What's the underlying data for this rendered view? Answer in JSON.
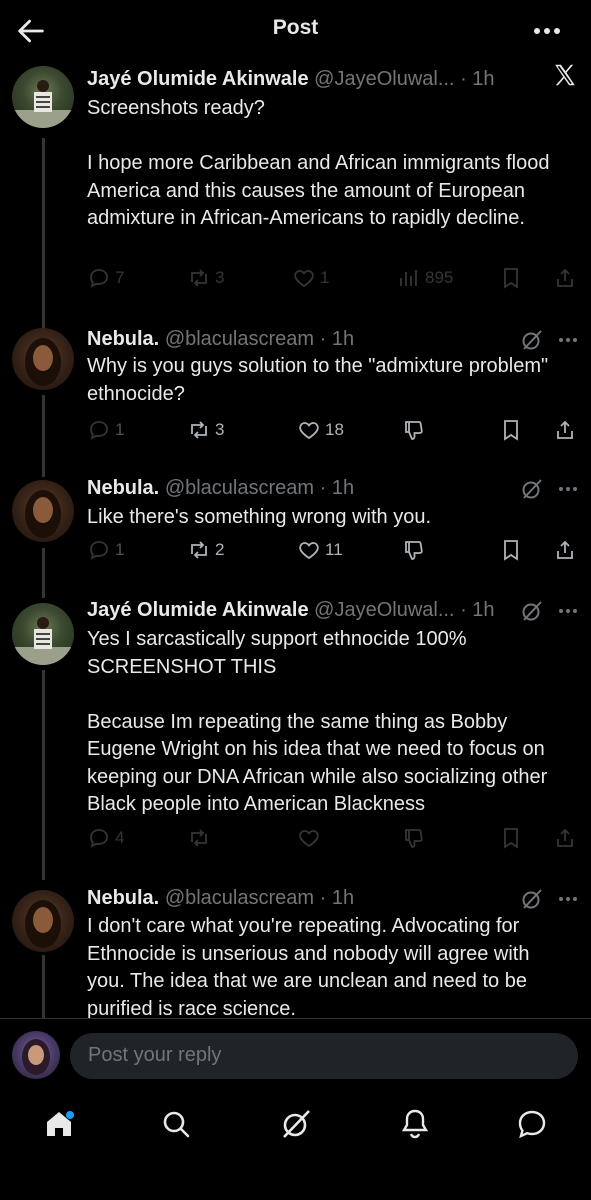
{
  "header": {
    "title": "Post"
  },
  "posts": [
    {
      "name": "Jayé Olumide Akinwale",
      "handle": "@JayeOluwal...",
      "time": "· 1h",
      "text": "Screenshots ready?\n\nI hope more Caribbean and African immigrants flood America and this causes the amount of European admixture in African-Americans to rapidly decline.",
      "replies": "7",
      "reposts": "3",
      "likes": "1",
      "views": "895"
    },
    {
      "name": "Nebula.",
      "handle": "@blaculascream",
      "time": "· 1h",
      "text": "Why is you guys solution to the \"admixture problem\" ethnocide?",
      "replies": "1",
      "reposts": "3",
      "likes": "18"
    },
    {
      "name": "Nebula.",
      "handle": "@blaculascream",
      "time": "· 1h",
      "text": "Like there's something wrong with you.",
      "replies": "1",
      "reposts": "2",
      "likes": "11"
    },
    {
      "name": "Jayé Olumide Akinwale",
      "handle": "@JayeOluwal...",
      "time": "· 1h",
      "text": "Yes I sarcastically support ethnocide 100%\nSCREENSHOT THIS\n\nBecause Im repeating the same thing as Bobby Eugene Wright on his idea that we need to focus on keeping our DNA African while also socializing other Black people into American Blackness",
      "replies": "4"
    },
    {
      "name": "Nebula.",
      "handle": "@blaculascream",
      "time": "· 1h",
      "text": "I don't care what you're repeating. Advocating for Ethnocide is unserious and nobody will agree with you. The idea that we are unclean and need to be purified is race science."
    }
  ],
  "reply": {
    "placeholder": "Post your reply"
  },
  "nav": [
    "home-icon",
    "search-icon",
    "grok-icon",
    "notifications-icon",
    "messages-icon"
  ],
  "colors": {
    "background": "#000000",
    "text": "#e7e9ea",
    "secondary": "#71767b",
    "accent": "#1d9bf0"
  }
}
